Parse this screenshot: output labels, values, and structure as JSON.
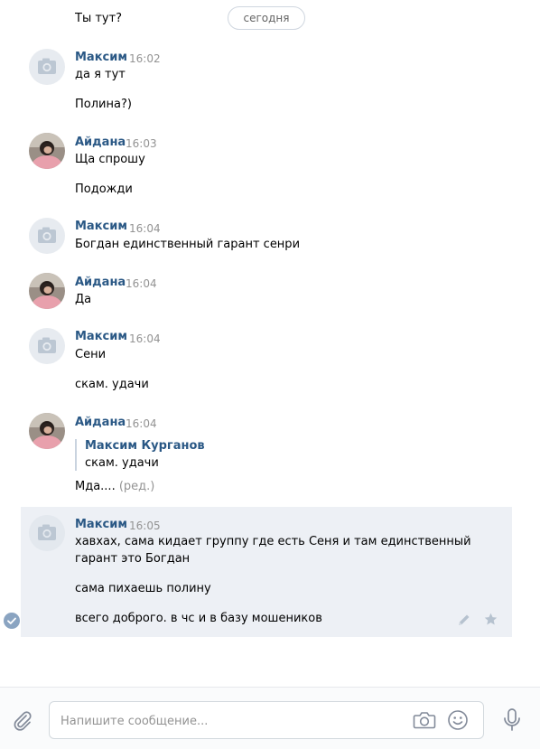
{
  "date_divider": "сегодня",
  "messages": [
    {
      "text": "Ты тут?"
    },
    {
      "author": "Максим",
      "time": "16:02",
      "lines": [
        "да я тут",
        "Полина?)"
      ]
    },
    {
      "author": "Айдана",
      "time": "16:03",
      "lines": [
        "Ща спрошу",
        "Подожди"
      ]
    },
    {
      "author": "Максим",
      "time": "16:04",
      "lines": [
        "Богдан единственный гарант сенри"
      ]
    },
    {
      "author": "Айдана",
      "time": "16:04",
      "lines": [
        "Да"
      ]
    },
    {
      "author": "Максим",
      "time": "16:04",
      "lines": [
        "Сени",
        "скам. удачи"
      ]
    },
    {
      "author": "Айдана",
      "time": "16:04",
      "quote": {
        "author": "Максим Курганов",
        "text": "скам. удачи"
      },
      "lines": [
        "Мда....",
        "(ред.)"
      ]
    },
    {
      "author": "Максим",
      "time": "16:05",
      "lines": [
        "хавхах, сама кидает группу где есть Сеня и там единственный",
        "гарант это Богдан",
        "сама пихаешь полину",
        "всего доброго. в чс и в базу мошеников"
      ]
    }
  ],
  "composer": {
    "placeholder": "Напишите сообщение..."
  },
  "colors": {
    "author": "#2a5885",
    "time": "#939393",
    "highlight": "#edf0f5",
    "avatar_placeholder": "#e7ebf0"
  },
  "icons": [
    "camera-placeholder-icon",
    "check-circle-icon",
    "pencil-icon",
    "star-icon",
    "paperclip-icon",
    "camera-icon",
    "smiley-icon",
    "microphone-icon"
  ]
}
